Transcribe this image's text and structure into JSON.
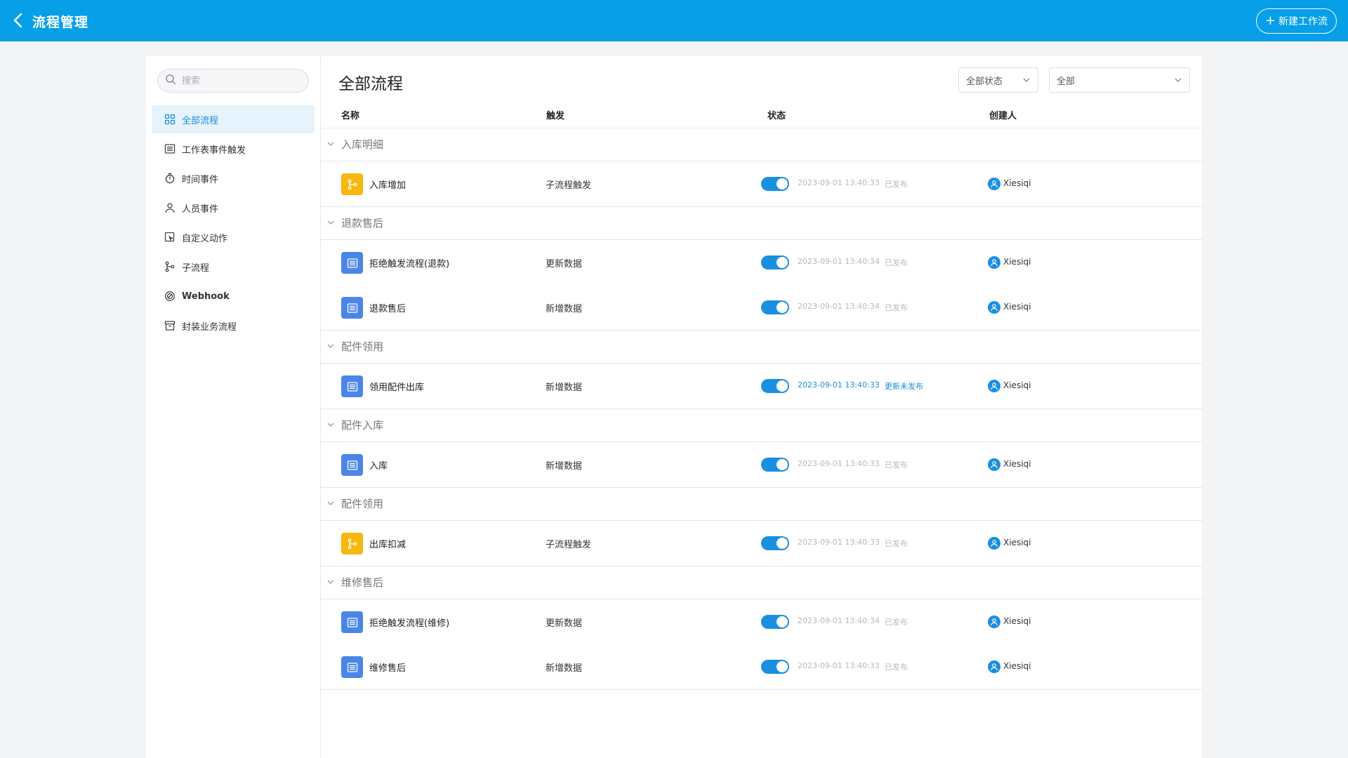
{
  "header": {
    "title": "流程管理",
    "new_button": "新建工作流"
  },
  "sidebar": {
    "search_placeholder": "搜索",
    "items": [
      {
        "label": "全部流程",
        "icon": "grid-icon"
      },
      {
        "label": "工作表事件触发",
        "icon": "list-icon"
      },
      {
        "label": "时间事件",
        "icon": "stopwatch-icon"
      },
      {
        "label": "人员事件",
        "icon": "user-icon"
      },
      {
        "label": "自定义动作",
        "icon": "custom-action-icon"
      },
      {
        "label": "子流程",
        "icon": "branch-icon"
      },
      {
        "label": "Webhook",
        "icon": "webhook-icon"
      },
      {
        "label": "封装业务流程",
        "icon": "archive-icon"
      }
    ],
    "active_index": 0
  },
  "main": {
    "title": "全部流程",
    "filters": {
      "status": "全部状态",
      "type": "全部"
    },
    "columns": {
      "name": "名称",
      "trigger": "触发",
      "status": "状态",
      "owner": "创建人"
    },
    "groups": [
      {
        "name": "入库明细",
        "rows": [
          {
            "name": "入库增加",
            "trigger": "子流程触发",
            "date": "2023-09-01 13:40:33",
            "state": "已发布",
            "owner": "Xiesiqi",
            "icon": "branch-icon",
            "color": "#f6b70e",
            "enabled": true
          }
        ]
      },
      {
        "name": "退款售后",
        "rows": [
          {
            "name": "拒绝触发流程(退款)",
            "trigger": "更新数据",
            "date": "2023-09-01 13:40:34",
            "state": "已发布",
            "owner": "Xiesiqi",
            "icon": "list-icon",
            "color": "#4a86e8",
            "enabled": true
          },
          {
            "name": "退款售后",
            "trigger": "新增数据",
            "date": "2023-09-01 13:40:34",
            "state": "已发布",
            "owner": "Xiesiqi",
            "icon": "list-icon",
            "color": "#4a86e8",
            "enabled": true
          }
        ]
      },
      {
        "name": "配件领用",
        "rows": [
          {
            "name": "领用配件出库",
            "trigger": "新增数据",
            "date": "2023-09-01 13:40:33",
            "state": "更新未发布",
            "owner": "Xiesiqi",
            "icon": "list-icon",
            "color": "#4a86e8",
            "enabled": true,
            "highlight": true
          }
        ]
      },
      {
        "name": "配件入库",
        "rows": [
          {
            "name": "入库",
            "trigger": "新增数据",
            "date": "2023-09-01 13:40:33",
            "state": "已发布",
            "owner": "Xiesiqi",
            "icon": "list-icon",
            "color": "#4a86e8",
            "enabled": true
          }
        ]
      },
      {
        "name": "配件领用",
        "rows": [
          {
            "name": "出库扣减",
            "trigger": "子流程触发",
            "date": "2023-09-01 13:40:33",
            "state": "已发布",
            "owner": "Xiesiqi",
            "icon": "branch-icon",
            "color": "#f6b70e",
            "enabled": true
          }
        ]
      },
      {
        "name": "维修售后",
        "rows": [
          {
            "name": "拒绝触发流程(维修)",
            "trigger": "更新数据",
            "date": "2023-09-01 13:40:34",
            "state": "已发布",
            "owner": "Xiesiqi",
            "icon": "list-icon",
            "color": "#4a86e8",
            "enabled": true
          },
          {
            "name": "维修售后",
            "trigger": "新增数据",
            "date": "2023-09-01 13:40:33",
            "state": "已发布",
            "owner": "Xiesiqi",
            "icon": "list-icon",
            "color": "#4a86e8",
            "enabled": true
          }
        ]
      }
    ]
  },
  "colors": {
    "header": "#069fe8",
    "accent": "#1a8fe0",
    "active_bg": "#e6f3fc"
  }
}
